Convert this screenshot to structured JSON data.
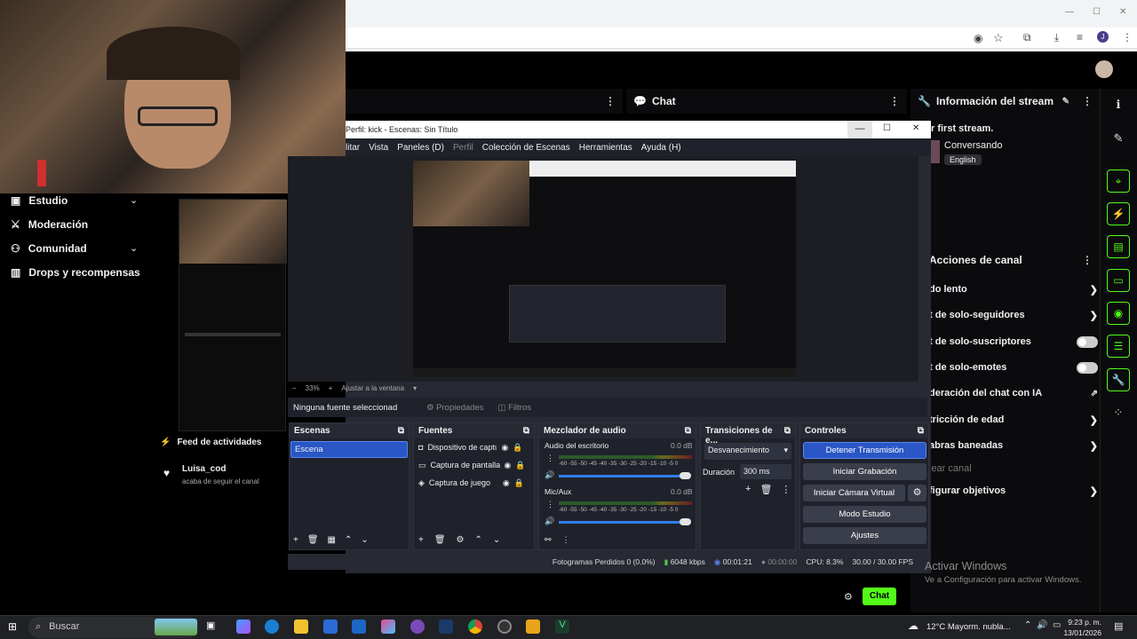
{
  "webcam": {
    "alt": "streamer webcam"
  },
  "left_nav": {
    "items": [
      {
        "label": "Estudio",
        "chevron": true
      },
      {
        "label": "Moderación",
        "chevron": false
      },
      {
        "label": "Comunidad",
        "chevron": true
      },
      {
        "label": "Drops y recompensas",
        "chevron": false
      }
    ]
  },
  "feed": {
    "title": "Feed de actividades",
    "user": "Luisa_cod",
    "action": "acaba de seguir el canal"
  },
  "kick": {
    "chat_panel": "Chat",
    "info_panel": "Información del stream",
    "stream_title": "r first stream.",
    "category": "Conversando",
    "language": "English",
    "actions_title": "Acciones de canal",
    "actions": [
      "do lento",
      "t de solo-seguidores",
      "t de solo-suscriptores",
      "t de solo-emotes",
      "deración del chat con IA",
      "tricción de edad",
      "abras baneadas",
      "lear canal",
      "figurar objetivos"
    ],
    "chat_button": "Chat"
  },
  "obs": {
    "title": "Perfil: kick - Escenas: Sin Título",
    "menu": [
      "litar",
      "Vista",
      "Paneles (D)",
      "Perfil",
      "Colección de Escenas",
      "Herramientas",
      "Ayuda (H)"
    ],
    "zoom": "33%",
    "fit_window": "Ajustar a la ventana",
    "no_source": "Ninguna fuente seleccionad",
    "properties": "Propiedades",
    "filters": "Filtros",
    "scenes_title": "Escenas",
    "scene_item": "Escena",
    "sources_title": "Fuentes",
    "sources": [
      "Dispositivo de captu",
      "Captura de pantalla",
      "Captura de juego"
    ],
    "mixer_title": "Mezclador de audio",
    "mixer": [
      {
        "name": "Audio del escritorio",
        "db": "0.0 dB"
      },
      {
        "name": "Mic/Aux",
        "db": "0.0 dB"
      }
    ],
    "meter_scale": "-60 -55 -50 -45 -40 -35 -30 -25 -20 -15 -10 -5 0",
    "transitions_title": "Transiciones de e...",
    "transition": "Desvanecimiento",
    "duration_label": "Duración",
    "duration_value": "300 ms",
    "controls_title": "Controles",
    "controls": [
      "Detener Transmisión",
      "Iniciar Grabación",
      "Iniciar Cámara Virtual",
      "Modo Estudio",
      "Ajustes"
    ],
    "status": {
      "dropped": "Fotogramas Perdidos 0 (0.0%)",
      "bitrate": "6048 kbps",
      "live_time": "00:01:21",
      "rec_time": "00:00:00",
      "cpu": "CPU: 8.3%",
      "fps": "30.00 / 30.00 FPS"
    }
  },
  "activate_windows": {
    "title": "Activar Windows",
    "subtitle": "Ve a Configuración para activar Windows."
  },
  "taskbar": {
    "search": "Buscar",
    "weather": "12°C  Mayorm. nubla...",
    "time": "9:23 p. m.",
    "date": "13/01/2026"
  },
  "colors": {
    "kick_green": "#53fc18",
    "obs_blue": "#2a56c6"
  }
}
